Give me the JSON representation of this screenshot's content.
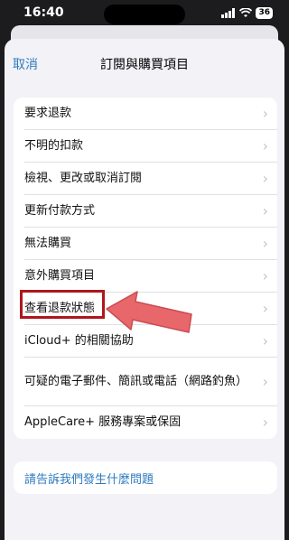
{
  "status": {
    "time": "16:40",
    "battery": "36"
  },
  "nav": {
    "cancel": "取消",
    "title": "訂閱與購買項目"
  },
  "items": [
    {
      "label": "要求退款"
    },
    {
      "label": "不明的扣款"
    },
    {
      "label": "檢視、更改或取消訂閱"
    },
    {
      "label": "更新付款方式"
    },
    {
      "label": "無法購買"
    },
    {
      "label": "意外購買項目"
    },
    {
      "label": "查看退款狀態"
    },
    {
      "label": "iCloud+ 的相關協助"
    },
    {
      "label": "可疑的電子郵件、簡訊或電話（網路釣魚）"
    },
    {
      "label": "AppleCare+ 服務專案或保固"
    }
  ],
  "footer_link": "請告訴我們發生什麼問題",
  "colors": {
    "accent": "#2f7bbf",
    "highlight": "#b0161c",
    "arrow": "#e8676b"
  }
}
